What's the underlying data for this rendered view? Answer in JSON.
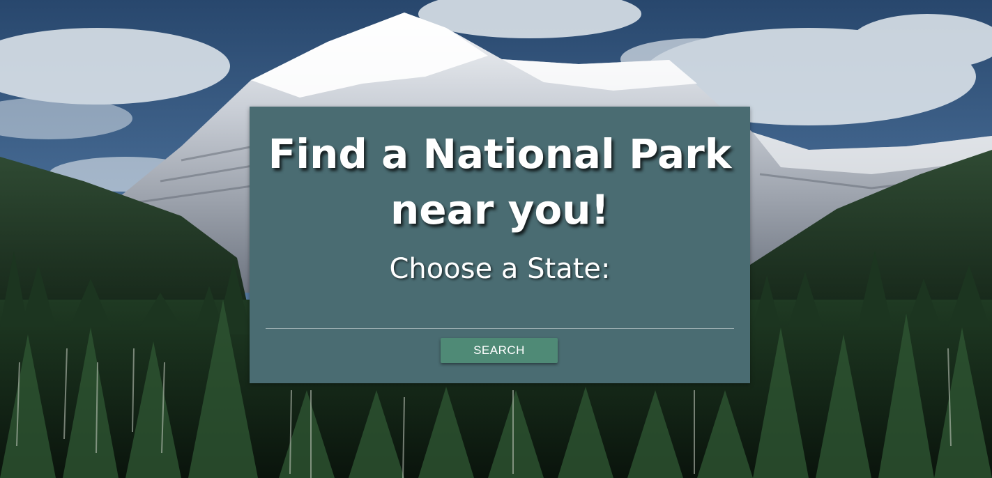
{
  "hero": {
    "headline": "Find a National Park near you!",
    "subheading": "Choose a State:"
  },
  "search": {
    "state_select_value": "",
    "button_label": "SEARCH"
  },
  "colors": {
    "panel": "#4a6c72",
    "button": "#4f8a76",
    "text": "#ffffff"
  }
}
